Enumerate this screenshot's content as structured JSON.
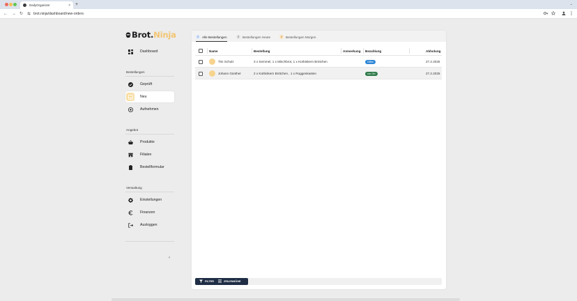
{
  "browser": {
    "tab_title": "DailyOrganizer",
    "tab_close": "×",
    "new_tab": "+",
    "tabs_menu": "⌄",
    "url": "brot.ninja/dashboard/new-orders",
    "back": "←",
    "forward": "→",
    "reload": "↻"
  },
  "sidebar": {
    "logo_main": "Brot.",
    "logo_accent": "Ninja",
    "dashboard_label": "Dashboard",
    "sections": {
      "bestellungen": "Bestellungen",
      "angebot": "Angebot",
      "verwaltung": "Verwaltung"
    },
    "items": {
      "geprueft": "Geprüft",
      "neu": "Neu",
      "aufnehmen": "Aufnehmen",
      "produkte": "Produkte",
      "filialen": "Filialen",
      "bestellformular": "Bestellformular",
      "einstellungen": "Einstellungen",
      "finanzen": "Finanzen",
      "ausloggen": "Ausloggen"
    },
    "collapse": "‹"
  },
  "tabs": [
    {
      "count": "2",
      "label": "Alle Bestellungen"
    },
    {
      "count": "2",
      "label": "Bestellungen Heute"
    },
    {
      "count": "2",
      "label": "Bestellungen Morgen"
    }
  ],
  "table": {
    "columns": {
      "name": "Name",
      "bestellung": "Bestellung",
      "anmerkung": "Anmerkung",
      "bezahlung": "Bezahlung",
      "abholung": "Abholung"
    },
    "rows": [
      {
        "name": "Tim Schulz",
        "bestellung": "3 x Semmel, 1 x Mischbrot, 1 x Kürbiskern Brötchen",
        "anmerkung": "",
        "bezahlung": "Offen",
        "abholung": "27.2.2025"
      },
      {
        "name": "Johann Günther",
        "bestellung": "2 x Kürbiskern Brötchen , 1 x Roggenkasten",
        "anmerkung": "",
        "bezahlung": "vor Ort",
        "abholung": "27.2.2025"
      }
    ]
  },
  "footer": {
    "filter_label": "FILTER",
    "rowheight_label": "ZEILENHÖHE"
  },
  "colors": {
    "accent": "#f2c571",
    "payment_open": "#2f86d6",
    "payment_onsite": "#2f7a49",
    "footer_bar": "#1f2d45"
  }
}
